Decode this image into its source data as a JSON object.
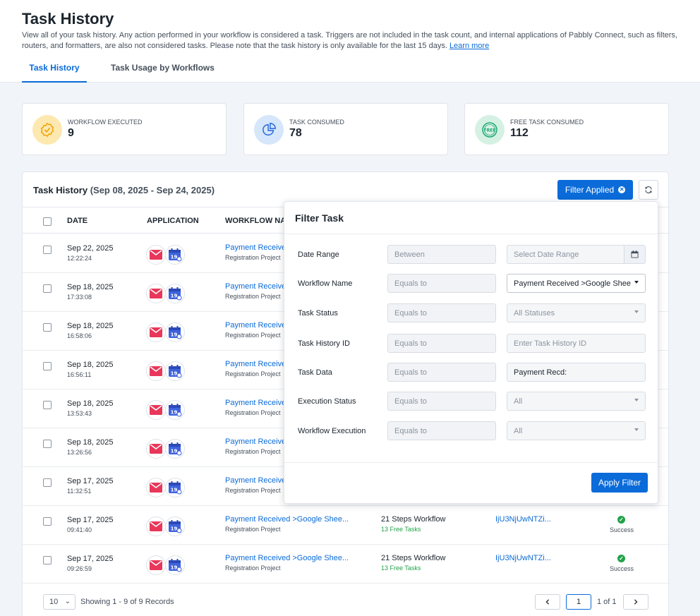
{
  "header": {
    "title": "Task History",
    "description": "View all of your task history. Any action performed in your workflow is considered a task. Triggers are not included in the task count, and internal applications of Pabbly Connect, such as filters, routers, and formatters, are also not considered tasks. Please note that the task history is only available for the last 15 days.",
    "learn_more": "Learn more",
    "tabs": [
      {
        "label": "Task History",
        "active": true
      },
      {
        "label": "Task Usage by Workflows",
        "active": false
      }
    ]
  },
  "stats": [
    {
      "label": "WORKFLOW EXECUTED",
      "value": "9",
      "icon": "badge-check-icon",
      "color": "#fde8b0"
    },
    {
      "label": "TASK CONSUMED",
      "value": "78",
      "icon": "pie-chart-icon",
      "color": "#d6e6fb"
    },
    {
      "label": "FREE TASK CONSUMED",
      "value": "112",
      "icon": "free-badge-icon",
      "color": "#d5f1e4"
    }
  ],
  "table": {
    "title": "Task History",
    "range": "(Sep 08, 2025 - Sep 24, 2025)",
    "filter_button": "Filter Applied",
    "columns": {
      "date": "DATE",
      "application": "APPLICATION",
      "workflow": "WORKFLOW NAI"
    },
    "rows": [
      {
        "date": "Sep 22, 2025",
        "time": "12:22:24",
        "workflow": "Payment Received",
        "project": "Registration Project"
      },
      {
        "date": "Sep 18, 2025",
        "time": "17:33:08",
        "workflow": "Payment Received",
        "project": "Registration Project"
      },
      {
        "date": "Sep 18, 2025",
        "time": "16:58:06",
        "workflow": "Payment Received",
        "project": "Registration Project"
      },
      {
        "date": "Sep 18, 2025",
        "time": "16:56:11",
        "workflow": "Payment Received",
        "project": "Registration Project"
      },
      {
        "date": "Sep 18, 2025",
        "time": "13:53:43",
        "workflow": "Payment Received",
        "project": "Registration Project"
      },
      {
        "date": "Sep 18, 2025",
        "time": "13:26:56",
        "workflow": "Payment Received",
        "project": "Registration Project"
      },
      {
        "date": "Sep 17, 2025",
        "time": "11:32:51",
        "workflow": "Payment Received",
        "project": "Registration Project"
      },
      {
        "date": "Sep 17, 2025",
        "time": "09:41:40",
        "workflow": "Payment Received >Google Shee...",
        "project": "Registration Project",
        "steps": "21 Steps Workflow",
        "free": "13 Free Tasks",
        "id": "IjU3NjUwNTZi...",
        "status": "Success"
      },
      {
        "date": "Sep 17, 2025",
        "time": "09:26:59",
        "workflow": "Payment Received >Google Shee...",
        "project": "Registration Project",
        "steps": "21 Steps Workflow",
        "free": "13 Free Tasks",
        "id": "IjU3NjUwNTZi...",
        "status": "Success"
      }
    ],
    "app_badge": "19"
  },
  "footer": {
    "page_size": "10",
    "showing": "Showing 1 - 9 of 9 Records",
    "current_page": "1",
    "of_pages": "1 of 1"
  },
  "filter_panel": {
    "title": "Filter Task",
    "fields": [
      {
        "label": "Date Range",
        "operator": "Between",
        "value": "Select Date Range",
        "kind": "date"
      },
      {
        "label": "Workflow Name",
        "operator": "Equals to",
        "value": "Payment Received >Google Shee",
        "kind": "select-active"
      },
      {
        "label": "Task Status",
        "operator": "Equals to",
        "value": "All Statuses",
        "kind": "select"
      },
      {
        "label": "Task History ID",
        "operator": "Equals to",
        "value": "Enter Task History ID",
        "kind": "input"
      },
      {
        "label": "Task Data",
        "operator": "Equals to",
        "value": "Payment Recd:",
        "kind": "input-filled"
      },
      {
        "label": "Execution Status",
        "operator": "Equals to",
        "value": "All",
        "kind": "select"
      },
      {
        "label": "Workflow Execution",
        "operator": "Equals to",
        "value": "All",
        "kind": "select"
      }
    ],
    "apply_button": "Apply Filter"
  }
}
